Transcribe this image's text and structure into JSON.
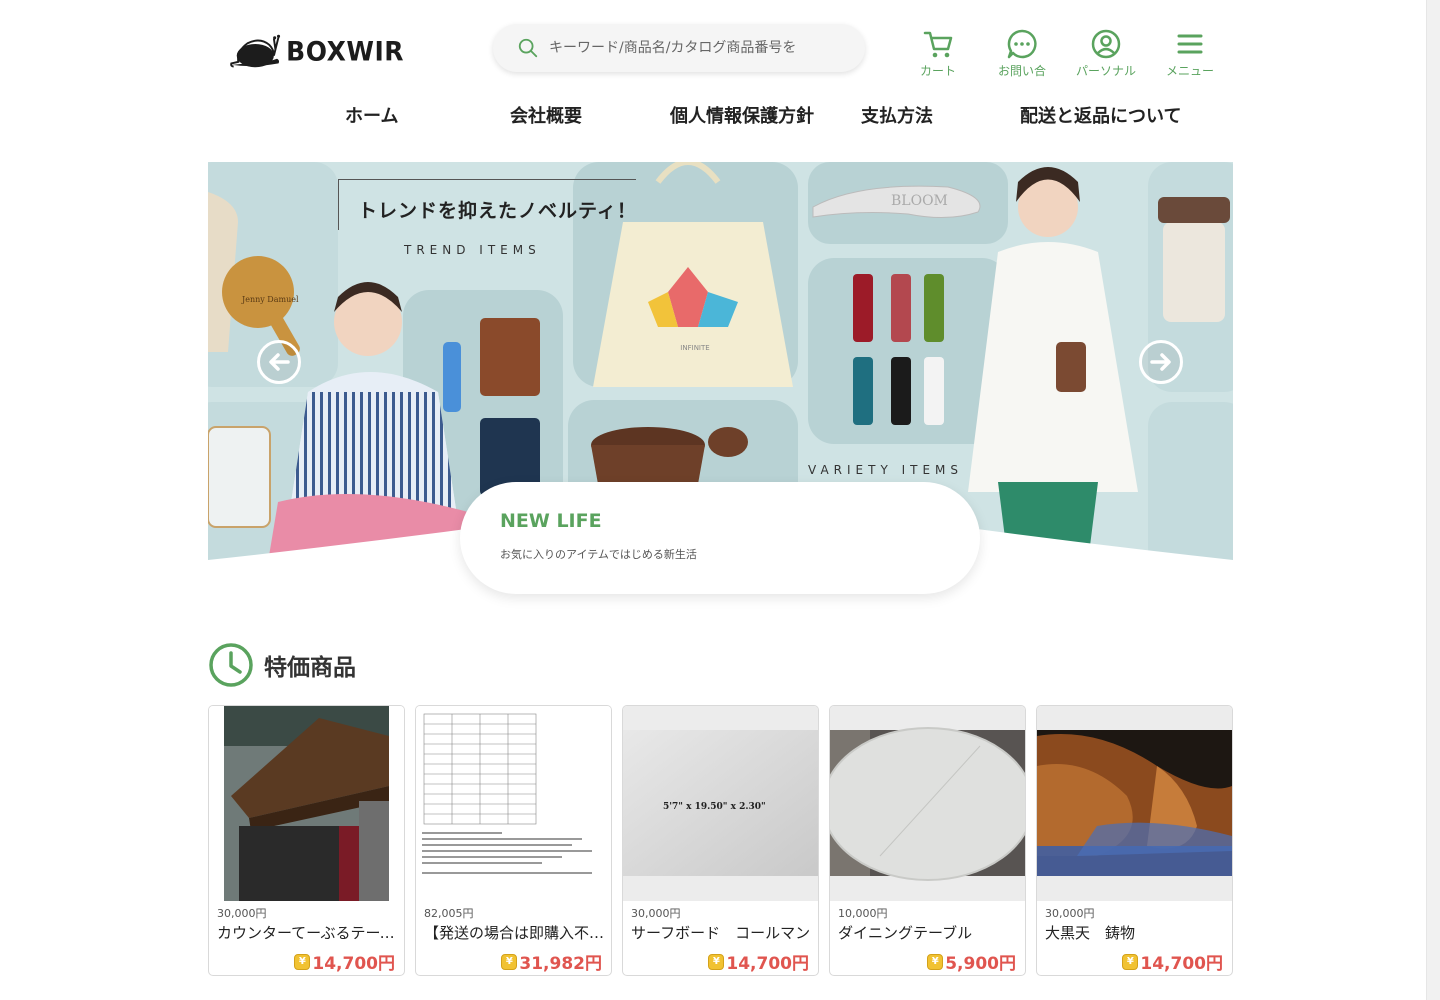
{
  "brand": {
    "name": "BOXWIR"
  },
  "search": {
    "placeholder": "キーワード/商品名/カタログ商品番号を"
  },
  "header_icons": [
    {
      "label": "カート",
      "icon": "cart-icon"
    },
    {
      "label": "お問い合",
      "icon": "chat-icon"
    },
    {
      "label": "パーソナル",
      "icon": "user-icon"
    },
    {
      "label": "メニュー",
      "icon": "menu-icon"
    }
  ],
  "nav": [
    "ホーム",
    "会社概要",
    "個人情報保護方針",
    "支払方法",
    "配送と返品について"
  ],
  "banner": {
    "headline": "トレンドを抑えたノベルティ！",
    "trend_label": "TREND ITEMS",
    "variety_label": "VARIETY ITEMS",
    "caption_title": "NEW LIFE",
    "caption_sub": "お気に入りのアイテムではじめる新生活"
  },
  "section": {
    "title": "特価商品"
  },
  "products": [
    {
      "orig": "30,000円",
      "name": "カウンターてーぶるテーブル",
      "price": "14,700円"
    },
    {
      "orig": "82,005円",
      "name": "【発送の場合は即購入不可】",
      "price": "31,982円"
    },
    {
      "orig": "30,000円",
      "name": "サーフボード　コールマン",
      "price": "14,700円"
    },
    {
      "orig": "10,000円",
      "name": "ダイニングテーブル",
      "price": "5,900円"
    },
    {
      "orig": "30,000円",
      "name": "大黒天　鋳物",
      "price": "14,700円"
    }
  ],
  "colors": {
    "accent": "#5aa35e",
    "price": "#e0554f",
    "banner_bg": "#cfe3e4"
  }
}
